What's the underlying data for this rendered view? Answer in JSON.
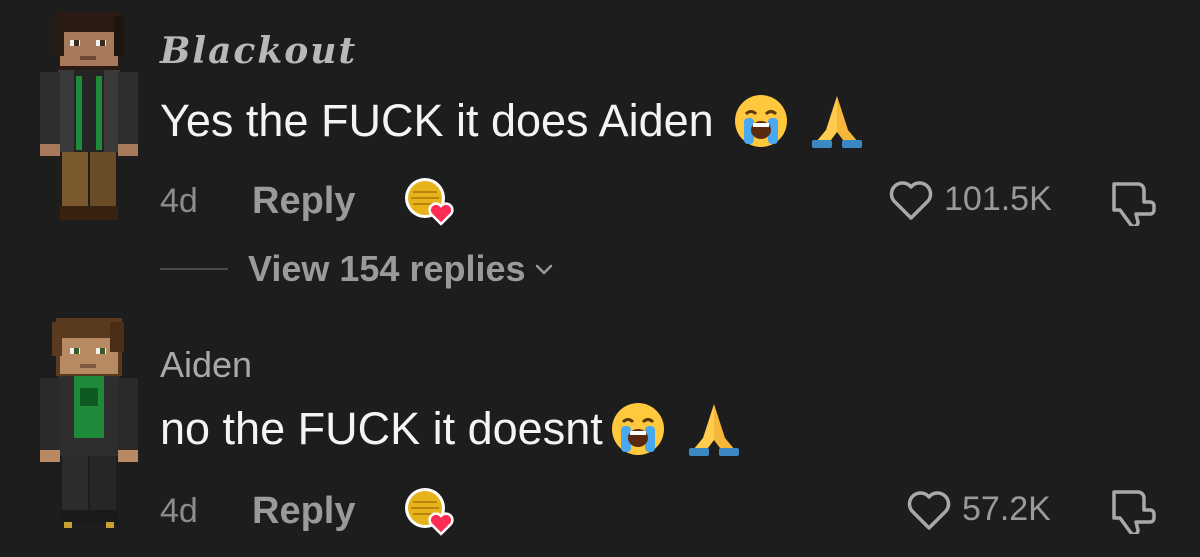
{
  "comments": [
    {
      "username": "Blackout",
      "text": "Yes the FUCK it does Aiden",
      "emojis": [
        "loudly-crying-face",
        "folded-hands"
      ],
      "time": "4d",
      "reply_label": "Reply",
      "likes": "101.5K",
      "view_replies": "View 154 replies"
    },
    {
      "username": "Aiden",
      "text": "no the FUCK it doesnt",
      "emojis": [
        "loudly-crying-face",
        "folded-hands"
      ],
      "time": "4d",
      "reply_label": "Reply",
      "likes": "57.2K"
    }
  ],
  "colors": {
    "background": "#1d1d1e",
    "text_primary": "#f4f4f4",
    "text_secondary": "#9a9a9c",
    "creator_heart": "#fe2c55"
  }
}
